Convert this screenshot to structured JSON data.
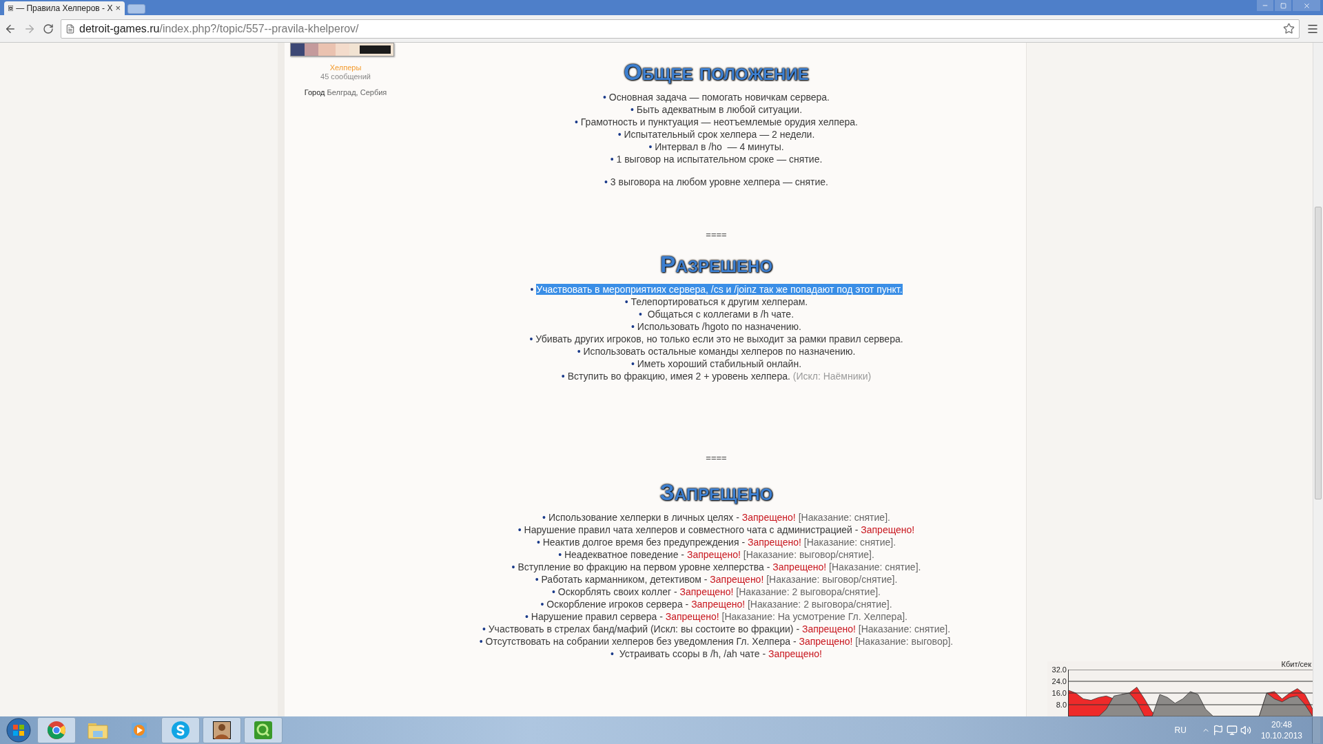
{
  "browser": {
    "tab_title": "— Правила Хелперов - Х",
    "tab_close": "×",
    "url_host": "detroit-games.ru",
    "url_path": "/index.php?/topic/557--pravila-khelperov/"
  },
  "author": {
    "group": "Хелперы",
    "posts": "45 сообщений",
    "city_label": "Город",
    "city_value": "Белград, Сербия"
  },
  "sections": [
    {
      "title": "Общее положение",
      "items": [
        {
          "bullet": "•",
          "selected": false,
          "parts": [
            {
              "kind": "normal",
              "text": "Основная задача — помогать новичкам сервера."
            }
          ]
        },
        {
          "bullet": "•",
          "selected": false,
          "parts": [
            {
              "kind": "normal",
              "text": "Быть адекватным в любой ситуации."
            }
          ]
        },
        {
          "bullet": "•",
          "selected": false,
          "parts": [
            {
              "kind": "normal",
              "text": "Грамотность и пунктуация — неотъемлемые орудия хелпера."
            }
          ]
        },
        {
          "bullet": "•",
          "selected": false,
          "parts": [
            {
              "kind": "normal",
              "text": "Испытательный срок хелпера — 2 недели."
            }
          ]
        },
        {
          "bullet": "•",
          "selected": false,
          "parts": [
            {
              "kind": "normal",
              "text": "Интервал в /ho  — 4 минуты."
            }
          ]
        },
        {
          "bullet": "•",
          "selected": false,
          "parts": [
            {
              "kind": "normal",
              "text": "1 выговор на испытательном сроке — снятие."
            }
          ]
        },
        {
          "bullet": "•",
          "selected": false,
          "spaced": true,
          "parts": [
            {
              "kind": "normal",
              "text": "3 выговора на любом уровне хелпера — снятие."
            }
          ]
        }
      ]
    },
    {
      "separator": "====",
      "title": "Разрешено",
      "items": [
        {
          "bullet": "•",
          "selected": true,
          "parts": [
            {
              "kind": "normal",
              "text": "Участвовать в мероприятиях сервера, /cs и /joinz так же попадают под этот пункт."
            }
          ]
        },
        {
          "bullet": "•",
          "selected": false,
          "parts": [
            {
              "kind": "normal",
              "text": "Телепортироваться к другим хелперам."
            }
          ]
        },
        {
          "bullet": "•",
          "selected": false,
          "parts": [
            {
              "kind": "normal",
              "text": " Общаться с коллегами в /h чате."
            }
          ]
        },
        {
          "bullet": "•",
          "selected": false,
          "parts": [
            {
              "kind": "normal",
              "text": "Использовать /hgoto по назначению."
            }
          ]
        },
        {
          "bullet": "•",
          "selected": false,
          "parts": [
            {
              "kind": "normal",
              "text": "Убивать других игроков, но только если это не выходит за рамки правил сервера."
            }
          ]
        },
        {
          "bullet": "•",
          "selected": false,
          "parts": [
            {
              "kind": "normal",
              "text": "Использовать остальные команды хелперов по назначению."
            }
          ]
        },
        {
          "bullet": "•",
          "selected": false,
          "parts": [
            {
              "kind": "normal",
              "text": "Иметь хороший стабильный онлайн."
            }
          ]
        },
        {
          "bullet": "•",
          "selected": false,
          "parts": [
            {
              "kind": "normal",
              "text": "Вступить во фракцию, имея 2 + уровень хелпера. "
            },
            {
              "kind": "note",
              "text": "(Искл: Наёмники)"
            }
          ]
        }
      ]
    },
    {
      "separator": "====",
      "title": "Запрещено",
      "items": [
        {
          "bullet": "•",
          "selected": false,
          "parts": [
            {
              "kind": "normal",
              "text": "Использование хелперки в личных целях - "
            },
            {
              "kind": "forbidden",
              "text": "Запрещено!"
            },
            {
              "kind": "penalty",
              "text": " [Наказание: снятие]."
            }
          ]
        },
        {
          "bullet": "•",
          "selected": false,
          "parts": [
            {
              "kind": "normal",
              "text": "Нарушение правил чата хелперов и совместного чата с администрацией - "
            },
            {
              "kind": "forbidden",
              "text": "Запрещено!"
            }
          ]
        },
        {
          "bullet": "•",
          "selected": false,
          "parts": [
            {
              "kind": "normal",
              "text": "Неактив долгое время без предупреждения - "
            },
            {
              "kind": "forbidden",
              "text": "Запрещено!"
            },
            {
              "kind": "penalty",
              "text": " [Наказание: снятие]."
            }
          ]
        },
        {
          "bullet": "•",
          "selected": false,
          "parts": [
            {
              "kind": "normal",
              "text": "Неадекватное поведение - "
            },
            {
              "kind": "forbidden",
              "text": "Запрещено!"
            },
            {
              "kind": "penalty",
              "text": " [Наказание: выговор/снятие]."
            }
          ]
        },
        {
          "bullet": "•",
          "selected": false,
          "parts": [
            {
              "kind": "normal",
              "text": "Вступление во фракцию на первом уровне хелперства - "
            },
            {
              "kind": "forbidden",
              "text": "Запрещено!"
            },
            {
              "kind": "penalty",
              "text": " [Наказание: снятие]."
            }
          ]
        },
        {
          "bullet": "•",
          "selected": false,
          "parts": [
            {
              "kind": "normal",
              "text": "Работать карманником, детективом - "
            },
            {
              "kind": "forbidden",
              "text": "Запрещено!"
            },
            {
              "kind": "penalty",
              "text": " [Наказание: выговор/снятие]."
            }
          ]
        },
        {
          "bullet": "•",
          "selected": false,
          "parts": [
            {
              "kind": "normal",
              "text": "Оскорблять своих коллег - "
            },
            {
              "kind": "forbidden",
              "text": "Запрещено!"
            },
            {
              "kind": "penalty",
              "text": " [Наказание: 2 выговора/снятие]."
            }
          ]
        },
        {
          "bullet": "•",
          "selected": false,
          "parts": [
            {
              "kind": "normal",
              "text": "Оскорбление игроков сервера - "
            },
            {
              "kind": "forbidden",
              "text": "Запрещено!"
            },
            {
              "kind": "penalty",
              "text": " [Наказание: 2 выговора/снятие]."
            }
          ]
        },
        {
          "bullet": "•",
          "selected": false,
          "parts": [
            {
              "kind": "normal",
              "text": "Нарушение правил сервера - "
            },
            {
              "kind": "forbidden",
              "text": "Запрещено!"
            },
            {
              "kind": "penalty",
              "text": " [Наказание: На усмотрение Гл. Хелпера]."
            }
          ]
        },
        {
          "bullet": "•",
          "selected": false,
          "parts": [
            {
              "kind": "normal",
              "text": "Участвовать в стрелах банд/мафий (Искл: вы состоите во фракции) - "
            },
            {
              "kind": "forbidden",
              "text": "Запрещено!"
            },
            {
              "kind": "penalty",
              "text": " [Наказание: снятие]."
            }
          ]
        },
        {
          "bullet": "•",
          "selected": false,
          "parts": [
            {
              "kind": "normal",
              "text": "Отсутствовать на собрании хелперов без уведомления Гл. Хелпера - "
            },
            {
              "kind": "forbidden",
              "text": "Запрещено!"
            },
            {
              "kind": "penalty",
              "text": " [Наказание: выговор]."
            }
          ]
        },
        {
          "bullet": "•",
          "selected": false,
          "parts": [
            {
              "kind": "normal",
              "text": " Устраивать ссоры в /h, /ah чате - "
            },
            {
              "kind": "forbidden",
              "text": "Запрещено!"
            }
          ]
        }
      ]
    }
  ],
  "traffic_meter": {
    "unit": "Кбит/сек",
    "tick_labels": [
      "32.0",
      "24.0",
      "16.0",
      "8.0"
    ]
  },
  "taskbar": {
    "language": "RU",
    "time": "20:48",
    "date": "10.10.2013"
  }
}
